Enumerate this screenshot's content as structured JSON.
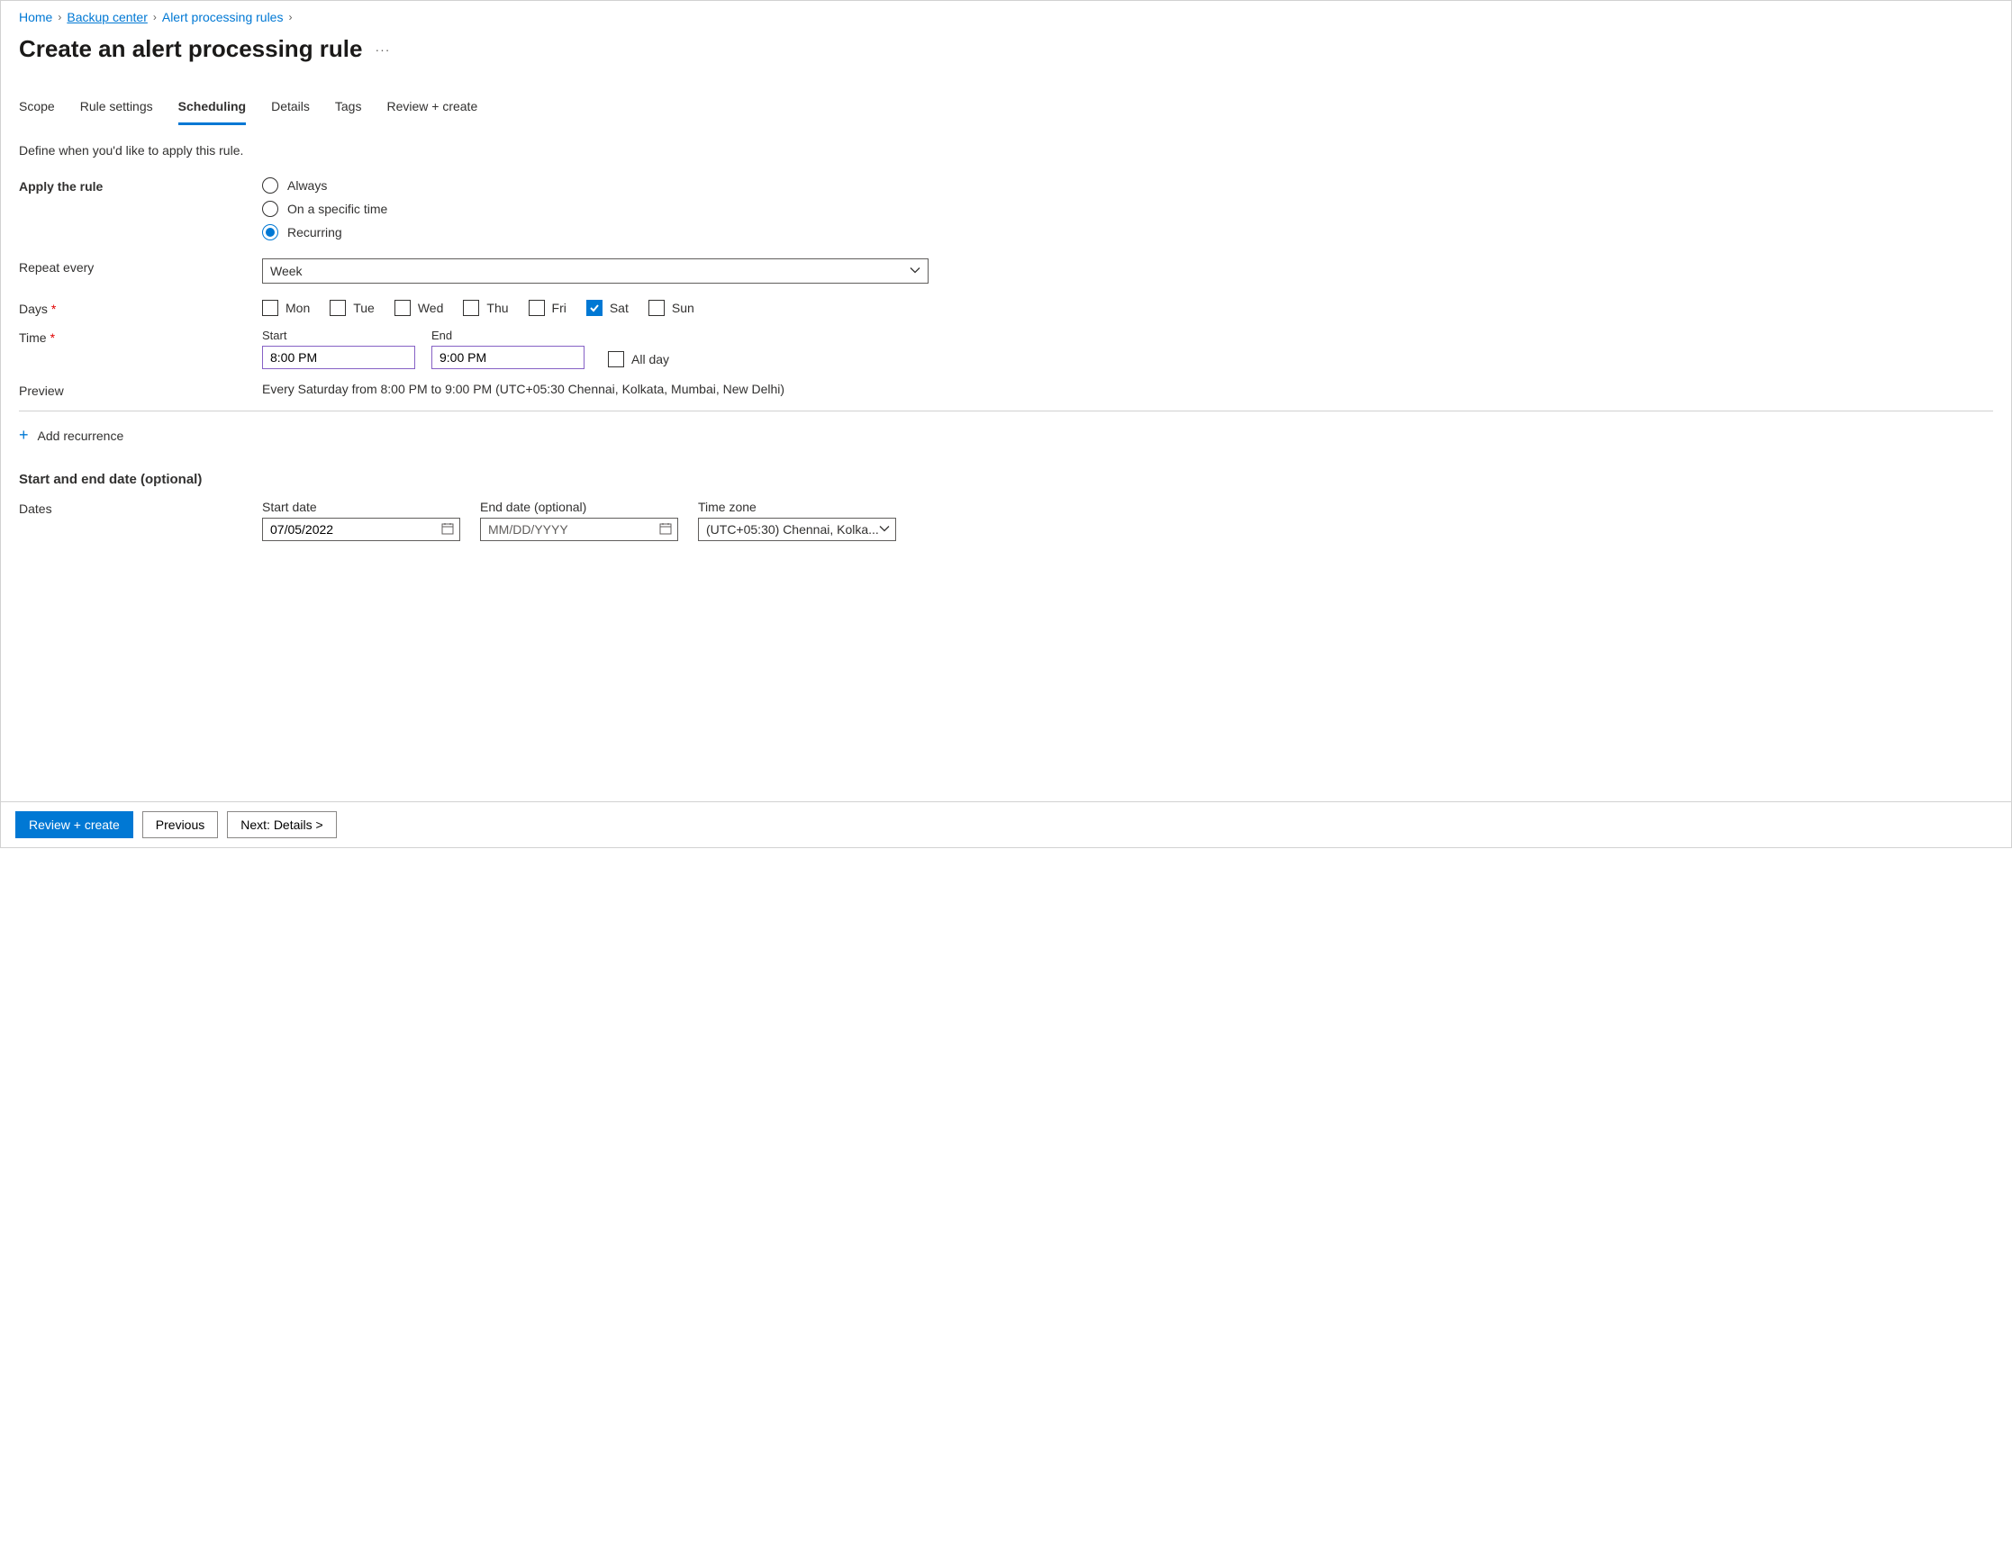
{
  "breadcrumb": {
    "items": [
      {
        "label": "Home"
      },
      {
        "label": "Backup center"
      },
      {
        "label": "Alert processing rules"
      }
    ]
  },
  "page": {
    "title": "Create an alert processing rule",
    "ellipsis": "···"
  },
  "tabs": [
    {
      "label": "Scope"
    },
    {
      "label": "Rule settings"
    },
    {
      "label": "Scheduling",
      "active": true
    },
    {
      "label": "Details"
    },
    {
      "label": "Tags"
    },
    {
      "label": "Review + create"
    }
  ],
  "description": "Define when you'd like to apply this rule.",
  "apply_rule": {
    "label": "Apply the rule",
    "options": [
      {
        "label": "Always",
        "selected": false
      },
      {
        "label": "On a specific time",
        "selected": false
      },
      {
        "label": "Recurring",
        "selected": true
      }
    ]
  },
  "repeat": {
    "label": "Repeat every",
    "value": "Week"
  },
  "days": {
    "label": "Days",
    "items": [
      {
        "label": "Mon",
        "checked": false
      },
      {
        "label": "Tue",
        "checked": false
      },
      {
        "label": "Wed",
        "checked": false
      },
      {
        "label": "Thu",
        "checked": false
      },
      {
        "label": "Fri",
        "checked": false
      },
      {
        "label": "Sat",
        "checked": true
      },
      {
        "label": "Sun",
        "checked": false
      }
    ]
  },
  "time": {
    "label": "Time",
    "start_label": "Start",
    "start_value": "8:00 PM",
    "end_label": "End",
    "end_value": "9:00 PM",
    "allday_label": "All day"
  },
  "preview": {
    "label": "Preview",
    "text": "Every Saturday from 8:00 PM to 9:00 PM (UTC+05:30 Chennai, Kolkata, Mumbai, New Delhi)"
  },
  "add_recurrence": {
    "label": "Add recurrence"
  },
  "start_end": {
    "heading": "Start and end date (optional)",
    "dates_label": "Dates",
    "start_label": "Start date",
    "start_value": "07/05/2022",
    "end_label": "End date (optional)",
    "end_placeholder": "MM/DD/YYYY",
    "tz_label": "Time zone",
    "tz_value": "(UTC+05:30) Chennai, Kolka..."
  },
  "footer": {
    "review": "Review + create",
    "previous": "Previous",
    "next": "Next: Details >"
  }
}
